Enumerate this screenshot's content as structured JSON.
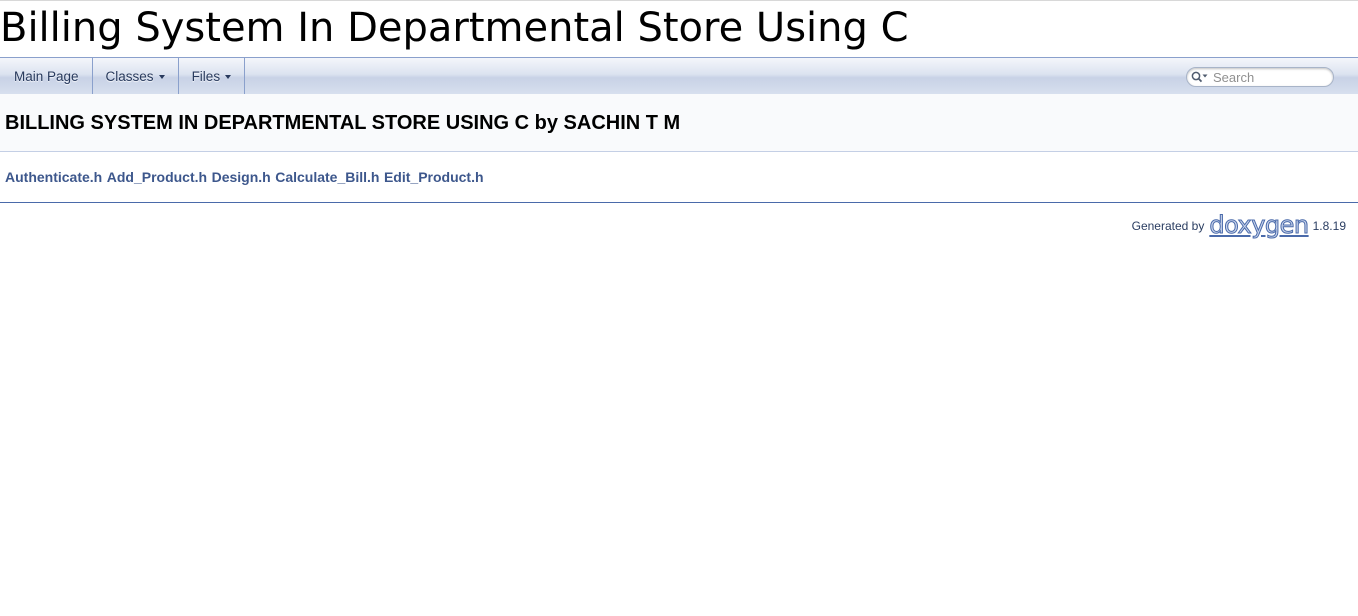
{
  "project": {
    "title": "Billing System In Departmental Store Using C"
  },
  "navbar": {
    "tabs": [
      {
        "label": "Main Page",
        "has_dropdown": false
      },
      {
        "label": "Classes",
        "has_dropdown": true
      },
      {
        "label": "Files",
        "has_dropdown": true
      }
    ],
    "search": {
      "placeholder": "Search",
      "icon": "magnifier-dropdown-icon"
    }
  },
  "page": {
    "title": "BILLING SYSTEM IN DEPARTMENTAL STORE USING C by SACHIN T M",
    "files": [
      "Authenticate.h",
      "Add_Product.h",
      "Design.h",
      "Calculate_Bill.h",
      "Edit_Product.h"
    ]
  },
  "footer": {
    "generated_by": "Generated by",
    "logo_text": "doxygen",
    "version": "1.8.19"
  },
  "colors": {
    "link": "#3d578c",
    "nav_text": "#283a5d",
    "nav_border": "#8aa0cc"
  }
}
